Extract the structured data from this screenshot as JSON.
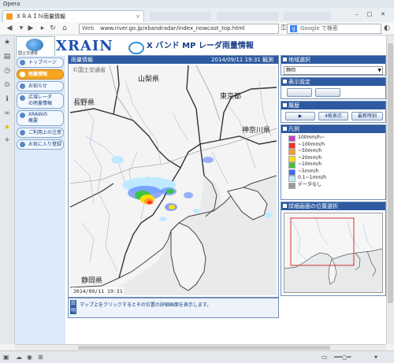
{
  "browser": {
    "app_name": "Opera",
    "tab_title": "ＸＲＡＩＮ雨量情報",
    "tab_close": "×",
    "address_label": "Web",
    "url": "www.river.go.jp/xbandradar/index_nowcast_top.html",
    "search_label": "Google で検索",
    "icons": [
      "back-icon",
      "forward-icon",
      "reload-icon",
      "home-icon",
      "key-icon",
      "star-icon",
      "note-icon",
      "history-icon",
      "info-icon",
      "link-icon",
      "speed-dial-icon",
      "settings-icon",
      "cloud-icon",
      "eye-icon",
      "download-icon",
      "pane-icon",
      "zoom-icon"
    ]
  },
  "site": {
    "logo_caption": "国土交通省",
    "title_main": "XRAIN",
    "title_sub": "X バンド MP レーダ雨量情報",
    "menu": [
      {
        "label": "トップページ",
        "active": false
      },
      {
        "label": "雨量情報",
        "active": true
      },
      {
        "label": "お知らせ",
        "active": false
      },
      {
        "label": "広域レーダ\nの雨量情報",
        "active": false
      },
      {
        "label": "XRAINの\n概要",
        "active": false
      },
      {
        "label": "ご利用上の注意",
        "active": false
      },
      {
        "label": "お気に入り登録",
        "active": false
      }
    ]
  },
  "map_panel": {
    "header_left": "雨量情報",
    "header_right": "2014/09/11 19:31  観測",
    "copyright": "©国土交通省",
    "timestamp": "2014/09/11 19:31",
    "labels": [
      "山梨県",
      "長野県",
      "東京都",
      "神奈川県",
      "静岡県"
    ],
    "note_tag": "説明",
    "note_text": "マップ上をクリックするとその位置の詳細画面を表示します。"
  },
  "right_panels": {
    "region": {
      "title": "地域選択",
      "selected": "静岡"
    },
    "display": {
      "title": "表示設定",
      "buttons": [
        "",
        ""
      ]
    },
    "history": {
      "title": "履歴",
      "buttons": [
        "",
        "4枚表示",
        "最新時刻"
      ]
    },
    "legend": {
      "title": "凡例",
      "items": [
        {
          "label": "100mm/h~",
          "color": "#c040d0"
        },
        {
          "label": "~100mm/h",
          "color": "#ff2a2a"
        },
        {
          "label": "~50mm/h",
          "color": "#ff9a2a"
        },
        {
          "label": "~20mm/h",
          "color": "#ffe100"
        },
        {
          "label": "~10mm/h",
          "color": "#3ec43e"
        },
        {
          "label": "~5mm/h",
          "color": "#3a6cff"
        },
        {
          "label": "0.1~1mm/h",
          "color": "#bfe9ff"
        },
        {
          "label": "データなし",
          "color": "#9a9a9a"
        }
      ]
    },
    "detail": {
      "title": "詳細画面の位置選択"
    }
  }
}
